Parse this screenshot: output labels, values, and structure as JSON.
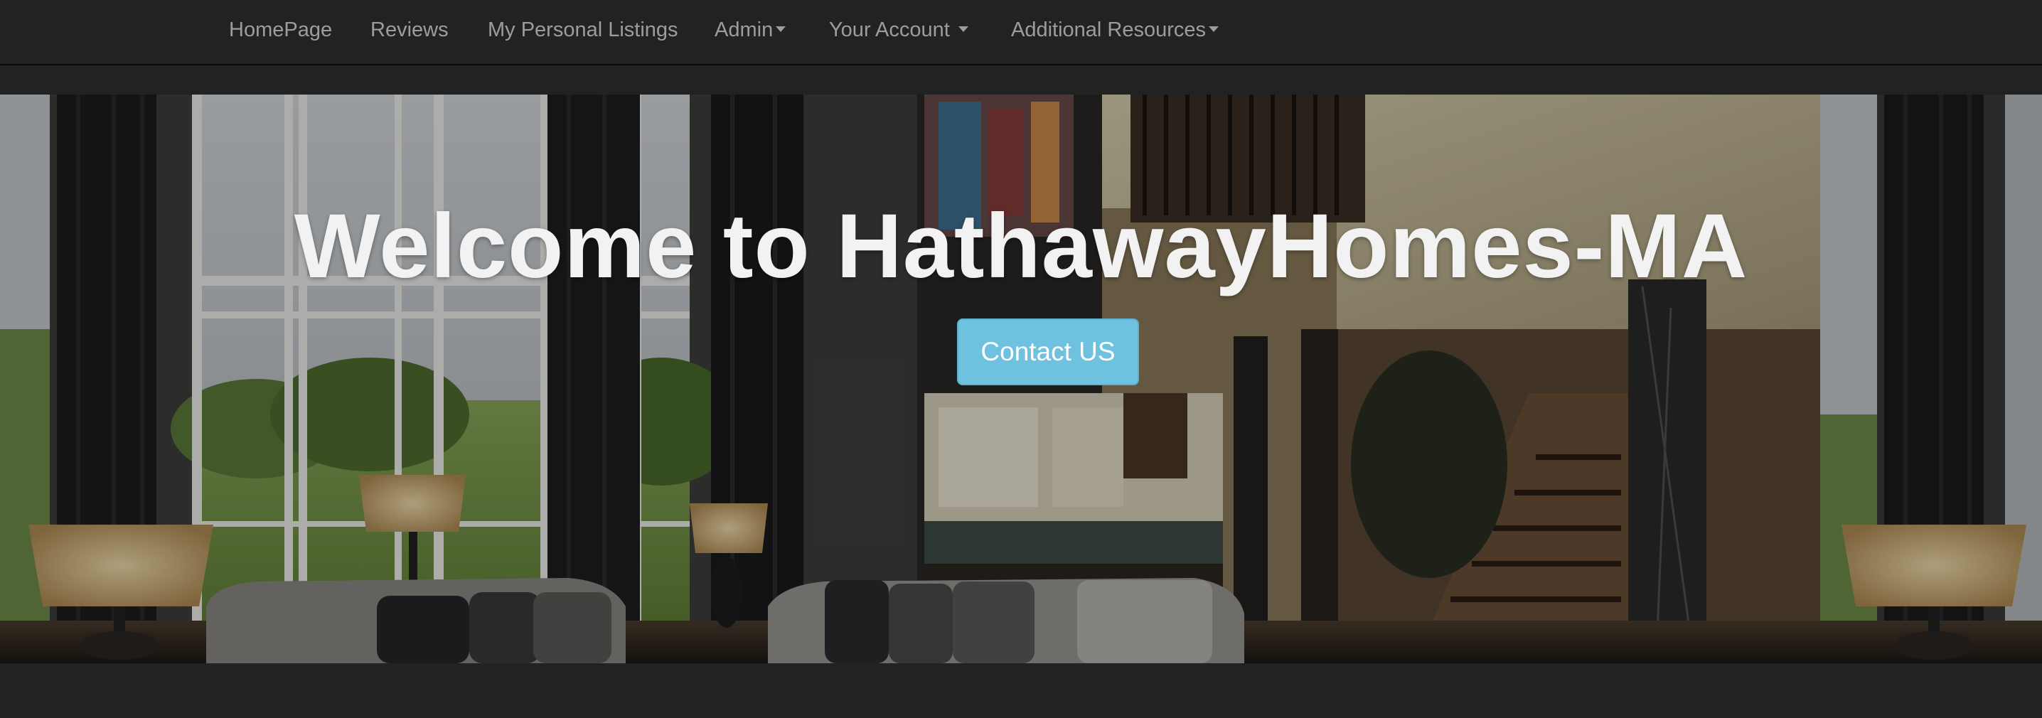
{
  "navbar": {
    "items": [
      {
        "label": "HomePage",
        "dropdown": false
      },
      {
        "label": "Reviews",
        "dropdown": false
      },
      {
        "label": "My Personal Listings",
        "dropdown": false
      },
      {
        "label": "Admin",
        "dropdown": true
      },
      {
        "label": "Your Account",
        "dropdown": true
      },
      {
        "label": "Additional Resources",
        "dropdown": true
      }
    ]
  },
  "hero": {
    "title": "Welcome to HathawayHomes-MA",
    "button_label": "Contact US"
  },
  "colors": {
    "navbar_bg": "#222222",
    "nav_text": "#9d9d9d",
    "button_bg": "#6ec1df",
    "title_text": "#f2f2f2"
  },
  "icons": [
    "caret-down-icon"
  ]
}
